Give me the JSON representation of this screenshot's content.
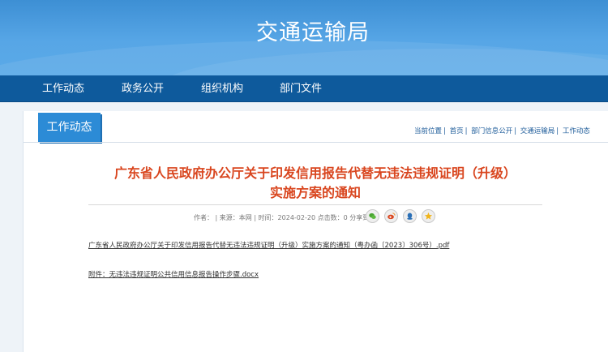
{
  "header": {
    "site_title": "交通运输局"
  },
  "nav": {
    "items": [
      {
        "label": "工作动态"
      },
      {
        "label": "政务公开"
      },
      {
        "label": "组织机构"
      },
      {
        "label": "部门文件"
      }
    ]
  },
  "section": {
    "tab_label": "工作动态"
  },
  "breadcrumb": {
    "current_label": "当前位置",
    "items": [
      "首页",
      "部门信息公开",
      "交通运输局",
      "工作动态"
    ]
  },
  "article": {
    "title_line1": "广东省人民政府办公厅关于印发信用报告代替无违法违规证明（升级）",
    "title_line2": "实施方案的通知",
    "meta": "作者：  | 来源：本网 | 时间：2024-02-20 点击数：0 分享到：",
    "attachments": [
      "广东省人民政府办公厅关于印发信用报告代替无违法违规证明（升级）实施方案的通知（粤办函〔2023〕306号）.pdf",
      "附件：无违法违规证明公共信用信息报告操作步骤.docx"
    ]
  },
  "share_icons": [
    "wechat-icon",
    "weibo-icon",
    "qq-icon",
    "qzone-icon"
  ],
  "colors": {
    "header_blue": "#4f9fe0",
    "nav_blue": "#0e5a9c",
    "tab_blue": "#2c8bd6",
    "title_red": "#d9461f",
    "breadcrumb_blue": "#1e5c9a"
  }
}
